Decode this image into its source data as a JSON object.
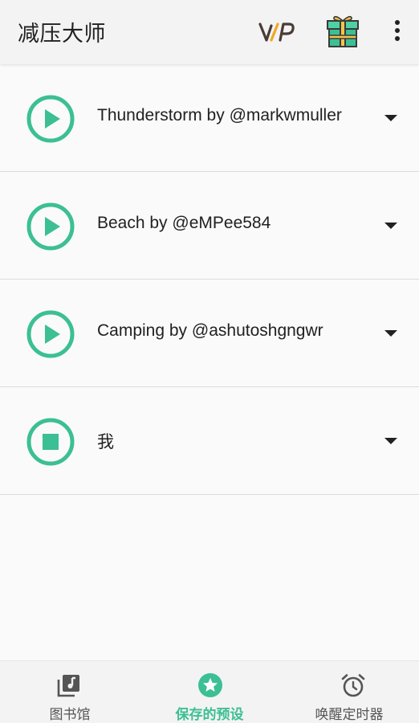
{
  "appbar": {
    "title": "减压大师",
    "vip_icon": "vip-icon",
    "gift_icon": "gift-icon",
    "more_icon": "more-vert-icon"
  },
  "presets": [
    {
      "label": "Thunderstorm by @markwmuller",
      "state": "stopped",
      "icon": "play-icon"
    },
    {
      "label": "Beach by @eMPee584",
      "state": "stopped",
      "icon": "play-icon"
    },
    {
      "label": "Camping by @ashutoshgngwr",
      "state": "stopped",
      "icon": "play-icon"
    },
    {
      "label": "我",
      "state": "playing",
      "icon": "stop-icon"
    }
  ],
  "bottom_nav": {
    "items": [
      {
        "label": "图书馆",
        "icon": "library-music-icon",
        "active": false
      },
      {
        "label": "保存的预设",
        "icon": "star-circle-icon",
        "active": true
      },
      {
        "label": "唤醒定时器",
        "icon": "alarm-clock-icon",
        "active": false
      }
    ]
  },
  "colors": {
    "accent": "#3cbf94",
    "text": "#212121",
    "appbar_bg": "#f3f3f3",
    "page_bg": "#fafafa"
  }
}
